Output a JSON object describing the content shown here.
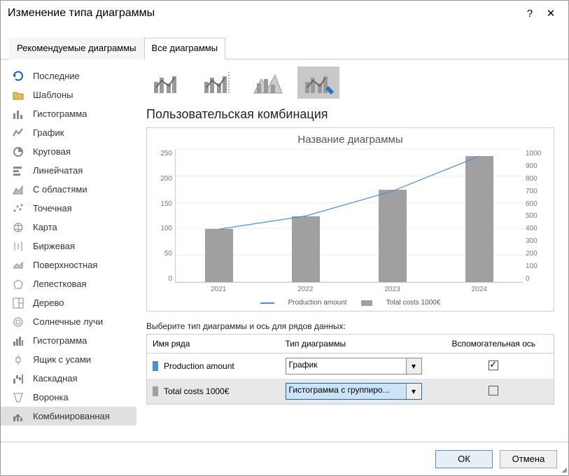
{
  "dialog": {
    "title": "Изменение типа диаграммы",
    "help_symbol": "?",
    "close_symbol": "✕"
  },
  "tabs": {
    "recommended": "Рекомендуемые диаграммы",
    "all": "Все диаграммы"
  },
  "sidebar": {
    "items": [
      {
        "label": "Последние",
        "icon": "recent-icon",
        "color": "#0b64c0"
      },
      {
        "label": "Шаблоны",
        "icon": "folder-icon",
        "color": "#e6b85c"
      },
      {
        "label": "Гистограмма",
        "icon": "bar-icon",
        "color": "#888"
      },
      {
        "label": "График",
        "icon": "line-icon",
        "color": "#888"
      },
      {
        "label": "Круговая",
        "icon": "pie-icon",
        "color": "#888"
      },
      {
        "label": "Линейчатая",
        "icon": "hbar-icon",
        "color": "#888"
      },
      {
        "label": "С областями",
        "icon": "area-icon",
        "color": "#888"
      },
      {
        "label": "Точечная",
        "icon": "scatter-icon",
        "color": "#888"
      },
      {
        "label": "Карта",
        "icon": "map-icon",
        "color": "#888"
      },
      {
        "label": "Биржевая",
        "icon": "stock-icon",
        "color": "#888"
      },
      {
        "label": "Поверхностная",
        "icon": "surface-icon",
        "color": "#888"
      },
      {
        "label": "Лепестковая",
        "icon": "radar-icon",
        "color": "#888"
      },
      {
        "label": "Дерево",
        "icon": "treemap-icon",
        "color": "#888"
      },
      {
        "label": "Солнечные лучи",
        "icon": "sunburst-icon",
        "color": "#888"
      },
      {
        "label": "Гистограмма",
        "icon": "histogram-icon",
        "color": "#888"
      },
      {
        "label": "Ящик с усами",
        "icon": "boxplot-icon",
        "color": "#888"
      },
      {
        "label": "Каскадная",
        "icon": "waterfall-icon",
        "color": "#888"
      },
      {
        "label": "Воронка",
        "icon": "funnel-icon",
        "color": "#888"
      },
      {
        "label": "Комбинированная",
        "icon": "combo-icon",
        "color": "#888"
      }
    ],
    "selected_index": 18
  },
  "section_title": "Пользовательская комбинация",
  "chart_preview": {
    "title": "Название диаграммы",
    "legend": {
      "series1": "Production amount",
      "series2": "Total costs 1000€"
    }
  },
  "chart_data": {
    "type": "combo",
    "categories": [
      "2021",
      "2022",
      "2023",
      "2024"
    ],
    "series": [
      {
        "name": "Production amount",
        "type": "line",
        "axis": "primary",
        "values": [
          100,
          125,
          172,
          238
        ]
      },
      {
        "name": "Total costs 1000€",
        "type": "bar",
        "axis": "secondary",
        "values": [
          400,
          500,
          700,
          950
        ]
      }
    ],
    "y_primary": {
      "min": 0,
      "max": 250,
      "ticks": [
        0,
        50,
        100,
        150,
        200,
        250
      ]
    },
    "y_secondary": {
      "min": 0,
      "max": 1000,
      "ticks": [
        0,
        100,
        200,
        300,
        400,
        500,
        600,
        700,
        800,
        900,
        1000
      ]
    }
  },
  "series_config": {
    "header": "Выберите тип диаграммы и ось для рядов данных:",
    "columns": {
      "name": "Имя ряда",
      "type": "Тип диаграммы",
      "sec_axis": "Вспомогательная ось"
    },
    "rows": [
      {
        "name": "Production amount",
        "swatch": "#4a90d9",
        "type_label": "График",
        "secondary": true,
        "selected": false
      },
      {
        "name": "Total costs 1000€",
        "swatch": "#a0a0a0",
        "type_label": "Гистограмма с группиро...",
        "secondary": false,
        "selected": true
      }
    ]
  },
  "footer": {
    "ok": "ОК",
    "cancel": "Отмена"
  }
}
